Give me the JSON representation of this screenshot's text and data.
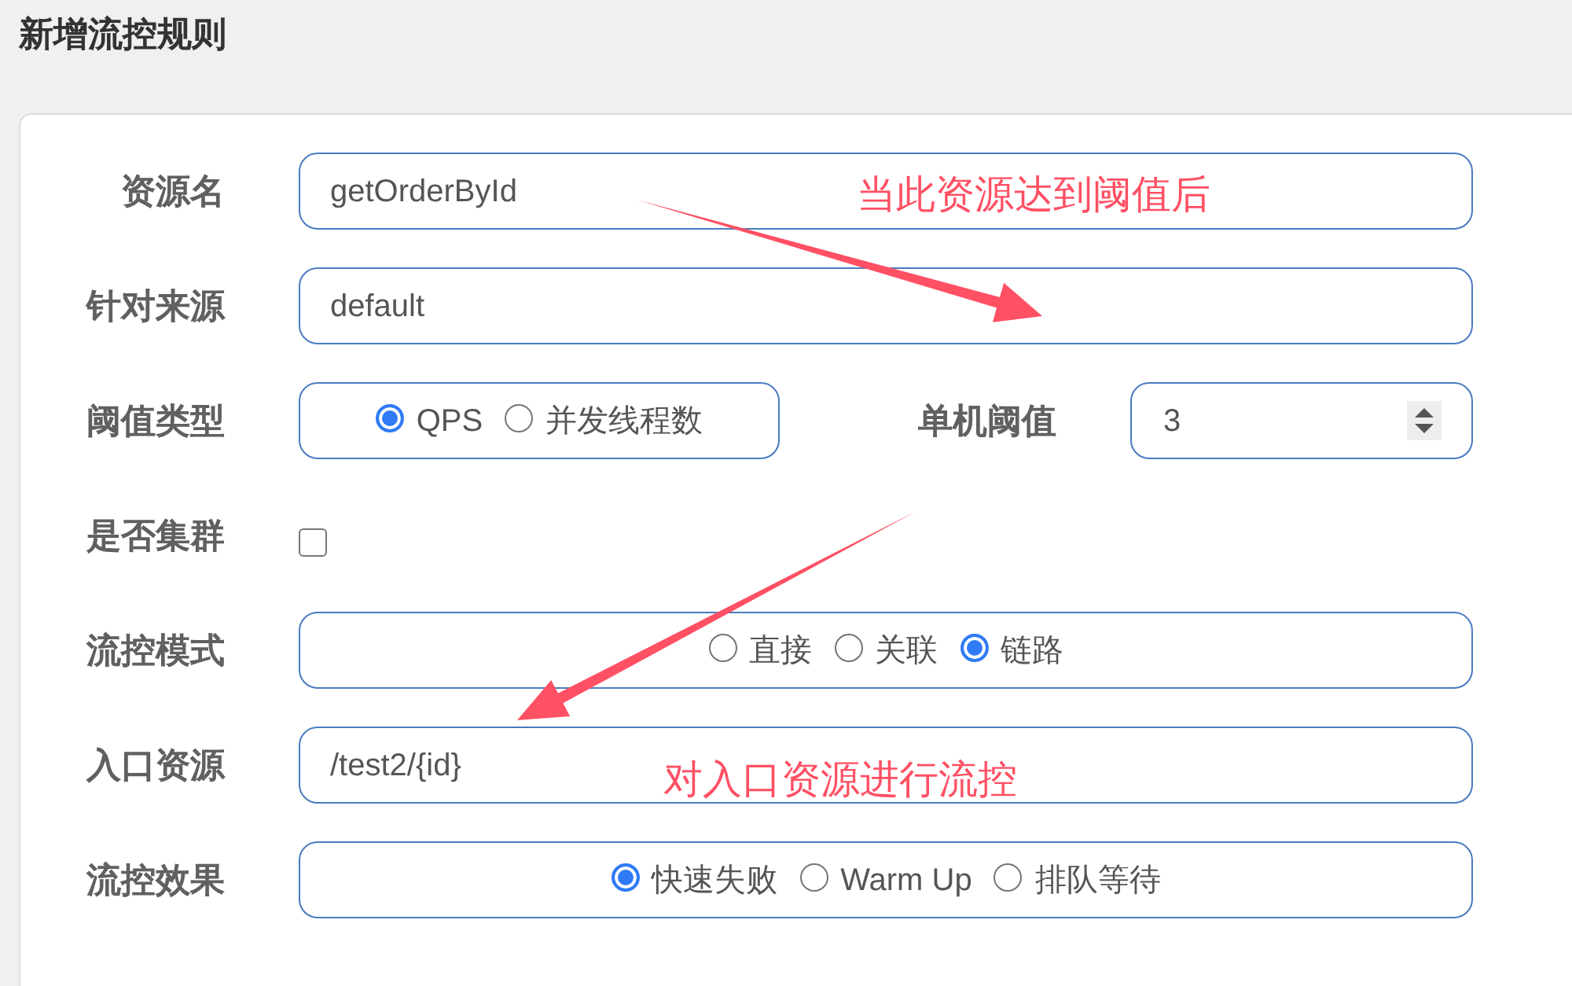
{
  "title": "新增流控规则",
  "rows": [
    {
      "kind": "text",
      "label": "资源名",
      "value": "getOrderById",
      "annotation": "当此资源达到阈值后"
    },
    {
      "kind": "text",
      "label": "针对来源",
      "value": "default"
    },
    {
      "kind": "radio",
      "label": "阈值类型",
      "options": [
        {
          "label": "QPS",
          "selected": true
        },
        {
          "label": "并发线程数",
          "selected": false
        }
      ],
      "side_field": {
        "label": "单机阈值",
        "value": "3"
      }
    },
    {
      "kind": "checkbox",
      "label": "是否集群",
      "checked": false
    },
    {
      "kind": "radio",
      "label": "流控模式",
      "options": [
        {
          "label": "直接",
          "selected": false
        },
        {
          "label": "关联",
          "selected": false
        },
        {
          "label": "链路",
          "selected": true
        }
      ]
    },
    {
      "kind": "text",
      "label": "入口资源",
      "value": "/test2/{id}",
      "annotation": "对入口资源进行流控"
    },
    {
      "kind": "radio",
      "label": "流控效果",
      "options": [
        {
          "label": "快速失败",
          "selected": true
        },
        {
          "label": "Warm Up",
          "selected": false
        },
        {
          "label": "排队等待",
          "selected": false
        }
      ]
    }
  ]
}
